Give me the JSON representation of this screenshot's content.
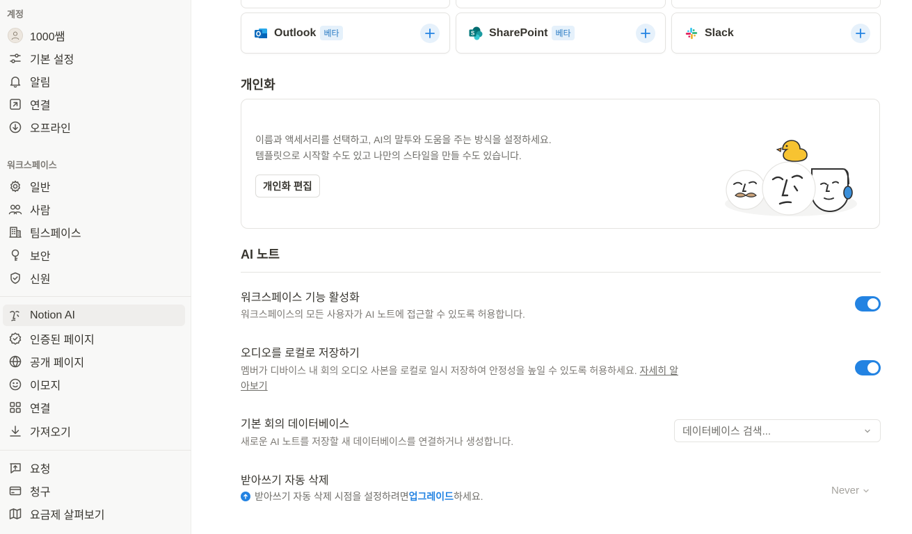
{
  "sidebar": {
    "account_label": "계정",
    "account_items": [
      {
        "label": "1000쌤"
      },
      {
        "label": "기본 설정"
      },
      {
        "label": "알림"
      },
      {
        "label": "연결"
      },
      {
        "label": "오프라인"
      }
    ],
    "workspace_label": "워크스페이스",
    "workspace_items": [
      {
        "label": "일반"
      },
      {
        "label": "사람"
      },
      {
        "label": "팀스페이스"
      },
      {
        "label": "보안"
      },
      {
        "label": "신원"
      }
    ],
    "feature_items": [
      {
        "label": "Notion AI",
        "active": true
      },
      {
        "label": "인증된 페이지"
      },
      {
        "label": "공개 페이지"
      },
      {
        "label": "이모지"
      },
      {
        "label": "연결"
      },
      {
        "label": "가져오기"
      }
    ],
    "billing_items": [
      {
        "label": "요청"
      },
      {
        "label": "청구"
      },
      {
        "label": "요금제 살펴보기"
      }
    ]
  },
  "integrations": [
    {
      "name": "Outlook",
      "badge": "베타",
      "icon": "outlook-icon"
    },
    {
      "name": "SharePoint",
      "badge": "베타",
      "icon": "sharepoint-icon"
    },
    {
      "name": "Slack",
      "badge": "",
      "icon": "slack-icon"
    }
  ],
  "personalization": {
    "title": "개인화",
    "desc_line1": "이름과 액세서리를 선택하고, AI의 말투와 도움을 주는 방식을 설정하세요.",
    "desc_line2": "템플릿으로 시작할 수도 있고 나만의 스타일을 만들 수도 있습니다.",
    "edit_button": "개인화 편집"
  },
  "ai_notes": {
    "title": "AI 노트",
    "settings": [
      {
        "title": "워크스페이스 기능 활성화",
        "desc": "워크스페이스의 모든 사용자가 AI 노트에 접근할 수 있도록 허용합니다.",
        "enabled": true
      },
      {
        "title": "오디오를 로컬로 저장하기",
        "desc_line1": "멤버가 디바이스 내 회의 오디오 사본을 로컬로 일시 저장하여 안정성을 높일 수 있도록 허용하세요.",
        "link_part1": "자세히 알",
        "link_part2": "아보기",
        "enabled": true
      },
      {
        "title": "기본 회의 데이터베이스",
        "desc": "새로운 AI 노트를 저장할 새 데이터베이스를 연결하거나 생성합니다.",
        "placeholder": "데이터베이스 검색..."
      },
      {
        "title": "받아쓰기 자동 삭제",
        "upgrade_prefix": "받아쓰기 자동 삭제 시점을 설정하려면 ",
        "upgrade_link": "업그레이드",
        "upgrade_suffix": "하세요.",
        "value": "Never"
      }
    ]
  },
  "colors": {
    "accent": "#2383e2",
    "sidebar_bg": "#f8f8f7",
    "text": "#37352f",
    "muted": "#7d7a75"
  }
}
